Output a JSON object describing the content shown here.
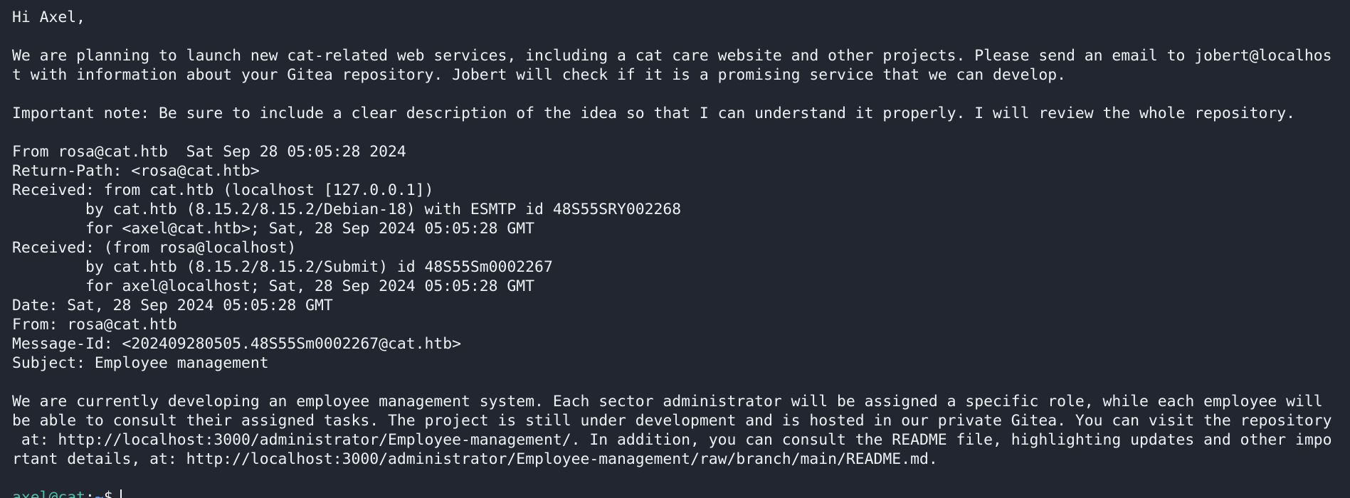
{
  "terminal": {
    "lines": [
      "Hi Axel,",
      "",
      "We are planning to launch new cat-related web services, including a cat care website and other projects. Please send an email to jobert@localhos",
      "t with information about your Gitea repository. Jobert will check if it is a promising service that we can develop.",
      "",
      "Important note: Be sure to include a clear description of the idea so that I can understand it properly. I will review the whole repository.",
      "",
      "From rosa@cat.htb  Sat Sep 28 05:05:28 2024",
      "Return-Path: <rosa@cat.htb>",
      "Received: from cat.htb (localhost [127.0.0.1])",
      "        by cat.htb (8.15.2/8.15.2/Debian-18) with ESMTP id 48S55SRY002268",
      "        for <axel@cat.htb>; Sat, 28 Sep 2024 05:05:28 GMT",
      "Received: (from rosa@localhost)",
      "        by cat.htb (8.15.2/8.15.2/Submit) id 48S55Sm0002267",
      "        for axel@localhost; Sat, 28 Sep 2024 05:05:28 GMT",
      "Date: Sat, 28 Sep 2024 05:05:28 GMT",
      "From: rosa@cat.htb",
      "Message-Id: <202409280505.48S55Sm0002267@cat.htb>",
      "Subject: Employee management",
      "",
      "We are currently developing an employee management system. Each sector administrator will be assigned a specific role, while each employee will",
      "be able to consult their assigned tasks. The project is still under development and is hosted in our private Gitea. You can visit the repository",
      " at: http://localhost:3000/administrator/Employee-management/. In addition, you can consult the README file, highlighting updates and other impo",
      "rtant details, at: http://localhost:3000/administrator/Employee-management/raw/branch/main/README.md.",
      ""
    ],
    "prompt": {
      "user_host": "axel@cat",
      "separator": ":",
      "path": "~",
      "symbol": "$"
    }
  },
  "colors": {
    "background": "#222631",
    "foreground": "#eef0f4",
    "prompt_user": "#4fc1a6",
    "prompt_path": "#6aa9ff"
  }
}
